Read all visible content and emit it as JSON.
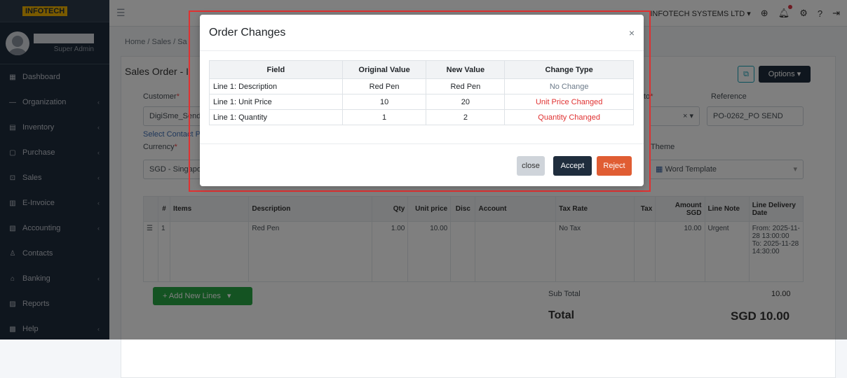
{
  "app": {
    "logo": "INFOTECH",
    "company": "INFOTECH SYSTEMS LTD"
  },
  "user": {
    "role": "Super Admin"
  },
  "sidebar": {
    "items": [
      {
        "label": "Dashboard",
        "icon": "dashboard-icon",
        "glyph": "▦"
      },
      {
        "label": "Organization",
        "icon": "organization-icon",
        "glyph": "—"
      },
      {
        "label": "Inventory",
        "icon": "inventory-icon",
        "glyph": "▤"
      },
      {
        "label": "Purchase",
        "icon": "purchase-icon",
        "glyph": "▢"
      },
      {
        "label": "Sales",
        "icon": "sales-icon",
        "glyph": "⊡"
      },
      {
        "label": "E-Invoice",
        "icon": "einvoice-icon",
        "glyph": "▥"
      },
      {
        "label": "Accounting",
        "icon": "accounting-icon",
        "glyph": "▧"
      },
      {
        "label": "Contacts",
        "icon": "contacts-icon",
        "glyph": "♙"
      },
      {
        "label": "Banking",
        "icon": "banking-icon",
        "glyph": "⌂"
      },
      {
        "label": "Reports",
        "icon": "reports-icon",
        "glyph": "▨"
      },
      {
        "label": "Help",
        "icon": "help-icon",
        "glyph": "▩"
      }
    ]
  },
  "breadcrumb": "Home / Sales / Sa",
  "page": {
    "title": "Sales Order - I",
    "options_label": "Options ▾",
    "customer_label": "Customer",
    "customer_value": "DigiSme_Send",
    "select_contact": "Select Contact P",
    "currency_label": "Currency",
    "currency_value": "SGD - Singapo",
    "to_label": "to",
    "reference_label": "Reference",
    "reference_value": "PO-0262_PO SEND",
    "theme_label": "Theme",
    "theme_value": "Word Template"
  },
  "lines": {
    "headers": [
      "#",
      "Items",
      "Description",
      "Qty",
      "Unit price",
      "Disc",
      "Account",
      "Tax Rate",
      "Tax",
      "Amount SGD",
      "Line Note",
      "Line Delivery Date"
    ],
    "row": {
      "num": "1",
      "description": "Red Pen",
      "qty": "1.00",
      "unit_price": "10.00",
      "tax_rate": "No Tax",
      "amount": "10.00",
      "line_note": "Urgent",
      "delivery": "From: 2025-11-28 13:00:00 To: 2025-11-28 14:30:00"
    },
    "add_label": "+ Add New Lines"
  },
  "totals": {
    "sub_total_label": "Sub Total",
    "sub_total_value": "10.00",
    "total_label": "Total",
    "total_value": "SGD 10.00"
  },
  "modal": {
    "title": "Order Changes",
    "close_glyph": "×",
    "headers": [
      "Field",
      "Original Value",
      "New Value",
      "Change Type"
    ],
    "rows": [
      {
        "field": "Line 1: Description",
        "original": "Red Pen",
        "new": "Red Pen",
        "change": "No Change"
      },
      {
        "field": "Line 1: Unit Price",
        "original": "10",
        "new": "20",
        "change": "Unit Price Changed"
      },
      {
        "field": "Line 1: Quantity",
        "original": "1",
        "new": "2",
        "change": "Quantity Changed"
      }
    ],
    "buttons": {
      "close": "close",
      "accept": "Accept",
      "reject": "Reject"
    }
  },
  "colors": {
    "sidebar": "#1f2d3d",
    "accent": "#e05d33",
    "changed": "#e03131",
    "highlight": "#e03131"
  }
}
